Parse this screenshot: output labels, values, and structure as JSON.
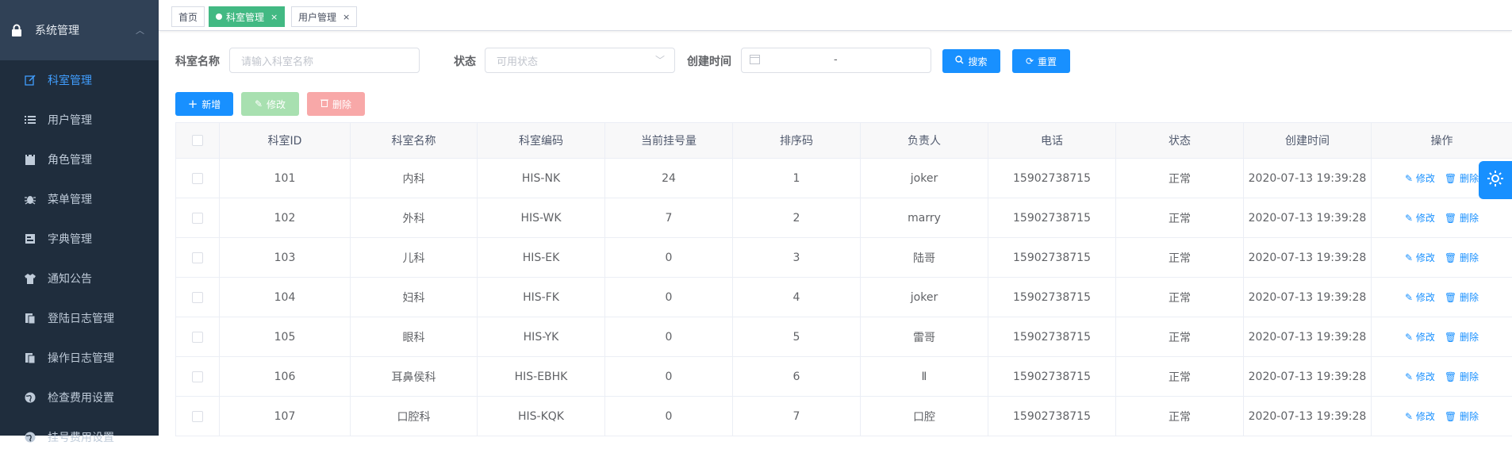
{
  "sidebar": {
    "group_label": "系统管理",
    "items": [
      {
        "label": "科室管理",
        "icon": "edit-icon",
        "active": true
      },
      {
        "label": "用户管理",
        "icon": "list-icon"
      },
      {
        "label": "角色管理",
        "icon": "role-icon"
      },
      {
        "label": "菜单管理",
        "icon": "bug-icon"
      },
      {
        "label": "字典管理",
        "icon": "dict-icon"
      },
      {
        "label": "通知公告",
        "icon": "shirt-icon"
      },
      {
        "label": "登陆日志管理",
        "icon": "log-icon"
      },
      {
        "label": "操作日志管理",
        "icon": "oplog-icon"
      },
      {
        "label": "检查费用设置",
        "icon": "globe-icon"
      },
      {
        "label": "挂号费用设置",
        "icon": "globe-icon"
      }
    ]
  },
  "tags": {
    "home": "首页",
    "active": "科室管理",
    "other": "用户管理",
    "close": "×"
  },
  "search": {
    "name_label": "科室名称",
    "name_placeholder": "请输入科室名称",
    "status_label": "状态",
    "status_placeholder": "可用状态",
    "time_label": "创建时间",
    "range_sep": "-",
    "search_btn": "搜索",
    "reset_btn": "重置"
  },
  "toolbar": {
    "add": "新增",
    "edit": "修改",
    "delete": "删除"
  },
  "table": {
    "headers": [
      "科室ID",
      "科室名称",
      "科室编码",
      "当前挂号量",
      "排序码",
      "负责人",
      "电话",
      "状态",
      "创建时间",
      "操作"
    ],
    "edit_label": "修改",
    "delete_label": "删除",
    "rows": [
      [
        "101",
        "内科",
        "HIS-NK",
        "24",
        "1",
        "joker",
        "15902738715",
        "正常",
        "2020-07-13 19:39:28"
      ],
      [
        "102",
        "外科",
        "HIS-WK",
        "7",
        "2",
        "marry",
        "15902738715",
        "正常",
        "2020-07-13 19:39:28"
      ],
      [
        "103",
        "儿科",
        "HIS-EK",
        "0",
        "3",
        "陆哥",
        "15902738715",
        "正常",
        "2020-07-13 19:39:28"
      ],
      [
        "104",
        "妇科",
        "HIS-FK",
        "0",
        "4",
        "joker",
        "15902738715",
        "正常",
        "2020-07-13 19:39:28"
      ],
      [
        "105",
        "眼科",
        "HIS-YK",
        "0",
        "5",
        "雷哥",
        "15902738715",
        "正常",
        "2020-07-13 19:39:28"
      ],
      [
        "106",
        "耳鼻侯科",
        "HIS-EBHK",
        "0",
        "6",
        "Ⅱ",
        "15902738715",
        "正常",
        "2020-07-13 19:39:28"
      ],
      [
        "107",
        "口腔科",
        "HIS-KQK",
        "0",
        "7",
        "口腔",
        "15902738715",
        "正常",
        "2020-07-13 19:39:28"
      ]
    ]
  },
  "colors": {
    "sidebar_bg": "#1f2d3d",
    "accent": "#1890ff",
    "tag_active": "#42b983"
  }
}
